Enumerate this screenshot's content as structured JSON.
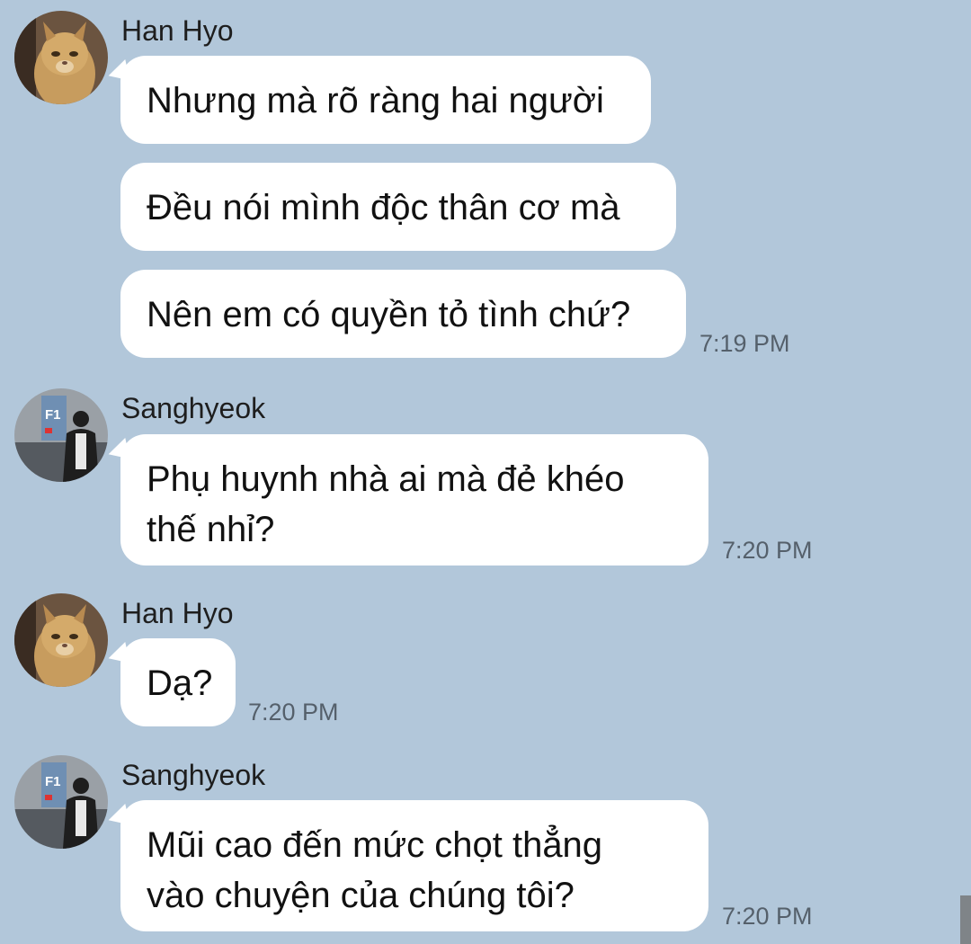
{
  "messages": [
    {
      "sender": "Han Hyo",
      "avatar": "cat-avatar",
      "texts": [
        "Nhưng mà rõ ràng hai người",
        "Đều nói mình độc thân cơ mà",
        "Nên em có quyền tỏ tình chứ?"
      ],
      "time": "7:19 PM"
    },
    {
      "sender": "Sanghyeok",
      "avatar": "person-avatar",
      "texts": [
        "Phụ huynh nhà ai mà đẻ khéo",
        "thế nhỉ?"
      ],
      "time": "7:20 PM"
    },
    {
      "sender": "Han Hyo",
      "avatar": "cat-avatar",
      "texts": [
        "Dạ?"
      ],
      "time": "7:20 PM"
    },
    {
      "sender": "Sanghyeok",
      "avatar": "person-avatar",
      "texts": [
        "Mũi cao đến mức chọt thẳng",
        "vào chuyện của chúng tôi?"
      ],
      "time": "7:20 PM"
    }
  ],
  "colors": {
    "background": "#b2c7da",
    "bubble": "#ffffff",
    "time": "#55606b"
  },
  "avatar_signs": {
    "floor": "F1"
  }
}
